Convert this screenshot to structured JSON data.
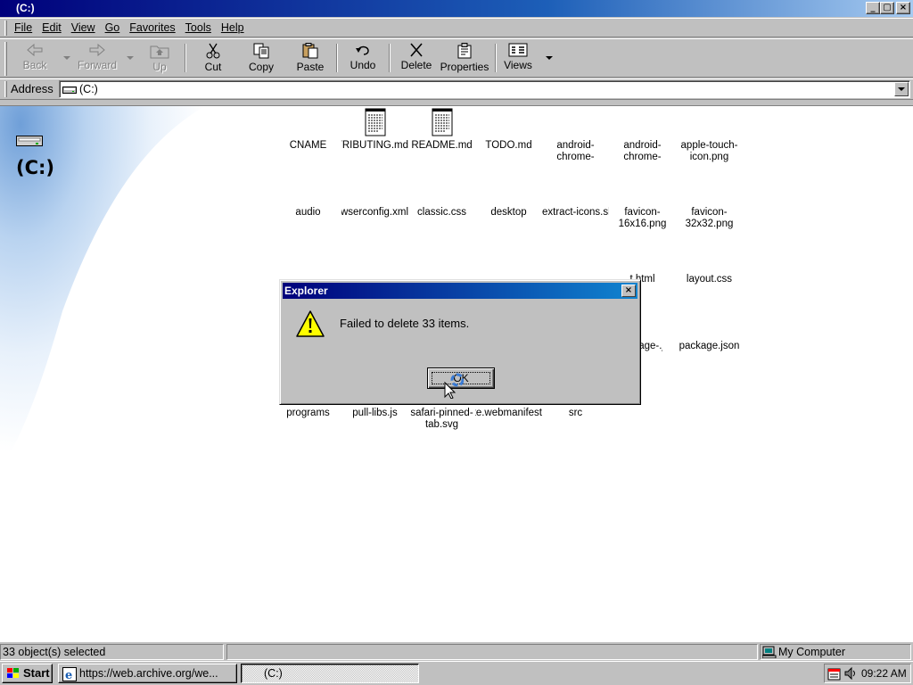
{
  "window": {
    "title": "(C:)",
    "caption_buttons": {
      "minimize": "_",
      "maximize": "▢",
      "close": "×"
    }
  },
  "menu": [
    "File",
    "Edit",
    "View",
    "Go",
    "Favorites",
    "Tools",
    "Help"
  ],
  "toolbar": {
    "back": "Back",
    "forward": "Forward",
    "up": "Up",
    "cut": "Cut",
    "copy": "Copy",
    "paste": "Paste",
    "undo": "Undo",
    "delete": "Delete",
    "properties": "Properties",
    "views": "Views"
  },
  "address": {
    "label": "Address",
    "value": "(C:)"
  },
  "content": {
    "drive_title": "(C:)",
    "files": [
      "CNAME",
      "CONTRIBUTING.md",
      "README.md",
      "TODO.md",
      "android-chrome-",
      "android-chrome-",
      "apple-touch-icon.png",
      "audio",
      "browserconfig.xml",
      "classic.css",
      "desktop",
      "extract-icons.sh",
      "favicon-16x16.png",
      "favicon-32x32.png",
      "t.html",
      "layout.css",
      "tage-.json",
      "package.json",
      "programs",
      "pull-libs.js",
      "safari-pinned-tab.svg",
      "site.webmanifest",
      "src"
    ]
  },
  "dialog": {
    "title": "Explorer",
    "close": "×",
    "message": "Failed to delete 33 items.",
    "ok": "OK"
  },
  "status": {
    "left": "33 object(s) selected",
    "middle": "",
    "right": "My Computer"
  },
  "taskbar": {
    "start": "Start",
    "tasks": [
      "https://web.archive.org/we...",
      "(C:)"
    ],
    "clock": "09:22 AM"
  }
}
